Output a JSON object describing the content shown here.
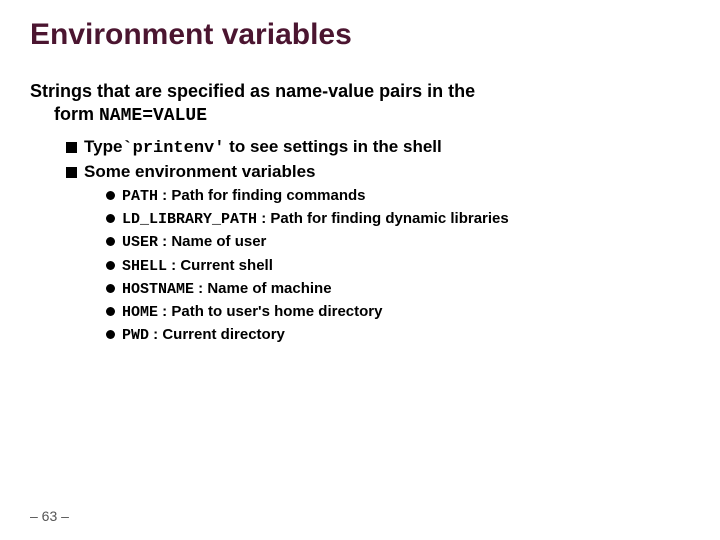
{
  "title": "Environment variables",
  "intro": {
    "line1": "Strings that are specified as name-value pairs in the",
    "line2_prefix": "form ",
    "line2_code": "NAME=VALUE"
  },
  "bullet1": {
    "prefix": "Type",
    "code": "`printenv'",
    "suffix": " to see settings in the shell"
  },
  "bullet2": "Some environment variables",
  "vars": [
    {
      "name": "PATH",
      "desc": " : Path for finding commands"
    },
    {
      "name": "LD_LIBRARY_PATH",
      "desc": " : Path for finding dynamic libraries"
    },
    {
      "name": "USER",
      "desc": " : Name of user"
    },
    {
      "name": "SHELL",
      "desc": " : Current shell"
    },
    {
      "name": "HOSTNAME",
      "desc": " : Name of machine"
    },
    {
      "name": "HOME",
      "desc": " : Path to user's home directory"
    },
    {
      "name": "PWD",
      "desc": " : Current directory"
    }
  ],
  "footer": "– 63 –"
}
